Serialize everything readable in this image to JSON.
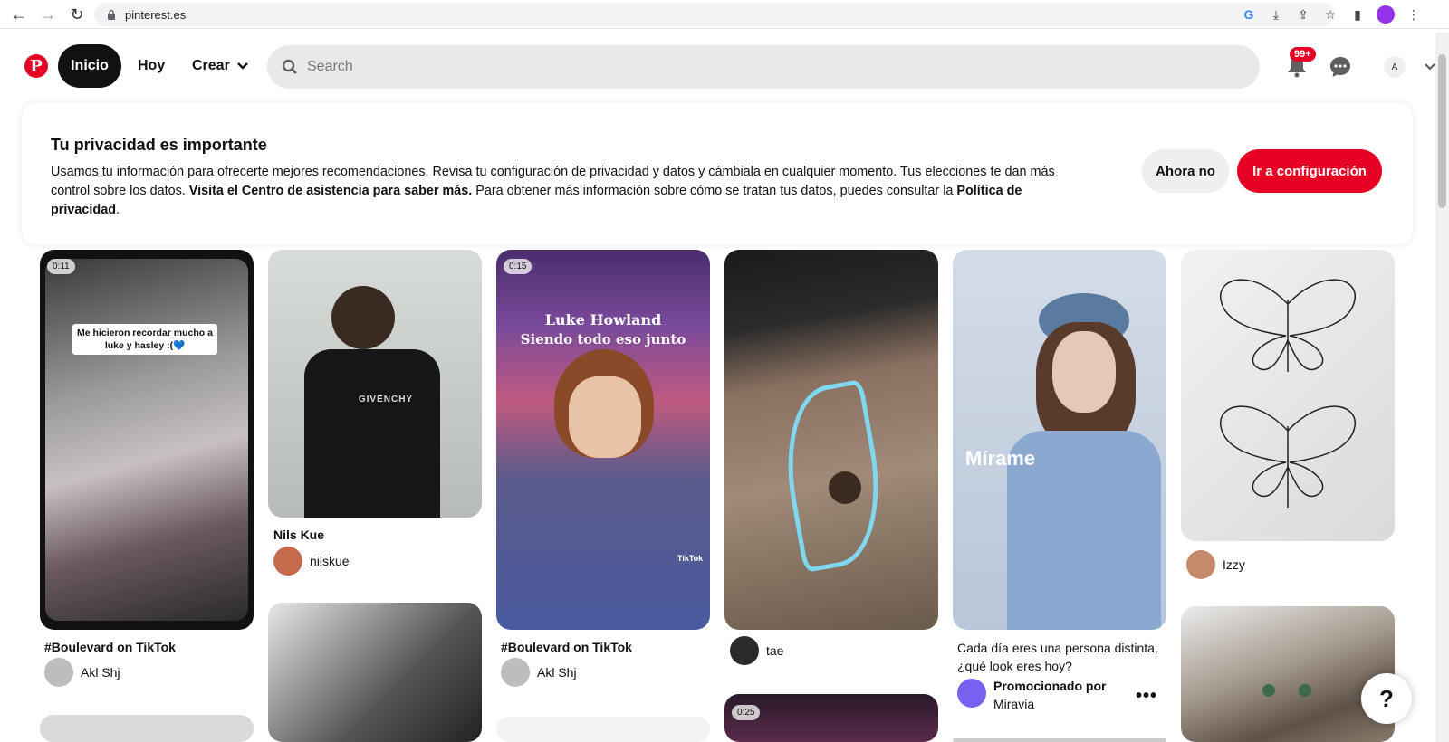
{
  "browser": {
    "url": "pinterest.es"
  },
  "header": {
    "logo_letter": "P",
    "tab_home": "Inicio",
    "tab_today": "Hoy",
    "tab_create": "Crear",
    "search_placeholder": "Search",
    "notification_count": "99+",
    "avatar_initial": "A"
  },
  "privacy": {
    "title": "Tu privacidad es importante",
    "text_1": "Usamos tu información para ofrecerte mejores recomendaciones. Revisa tu configuración de privacidad y datos y cámbiala en cualquier momento. Tus elecciones te dan más control sobre los datos. ",
    "link_help": "Visita el Centro de asistencia para saber más.",
    "text_2": " Para obtener más información sobre cómo se tratan tus datos, puedes consultar la ",
    "link_policy": "Política de privacidad",
    "text_3": ".",
    "btn_not_now": "Ahora no",
    "btn_settings": "Ir a configuración"
  },
  "pins": [
    {
      "duration": "0:11",
      "overlay": "Me hicieron recordar mucho a luke y hasley :(💙",
      "title": "#Boulevard on TikTok",
      "user": "Akl Shj"
    },
    {
      "title": "Nils Kue",
      "user": "nilskue",
      "overlay": "GIVENCHY"
    },
    {
      "duration": "0:15",
      "overlay_1": "Luke Howland",
      "overlay_2": "Siendo todo eso junto",
      "watermark": "TikTok",
      "title": "#Boulevard on TikTok",
      "user": "Akl Shj"
    },
    {
      "user": "tae",
      "duration_2": "0:25"
    },
    {
      "overlay": "Mírame",
      "title": "Cada día eres una persona distinta, ¿qué look eres hoy?",
      "promoted": "Promocionado por",
      "advertiser": "Miravia"
    },
    {
      "user": "Izzy"
    }
  ],
  "help_label": "?",
  "colors": {
    "brand": "#e60023",
    "active_tab": "#111111",
    "search_bg": "#e9e9e9"
  }
}
